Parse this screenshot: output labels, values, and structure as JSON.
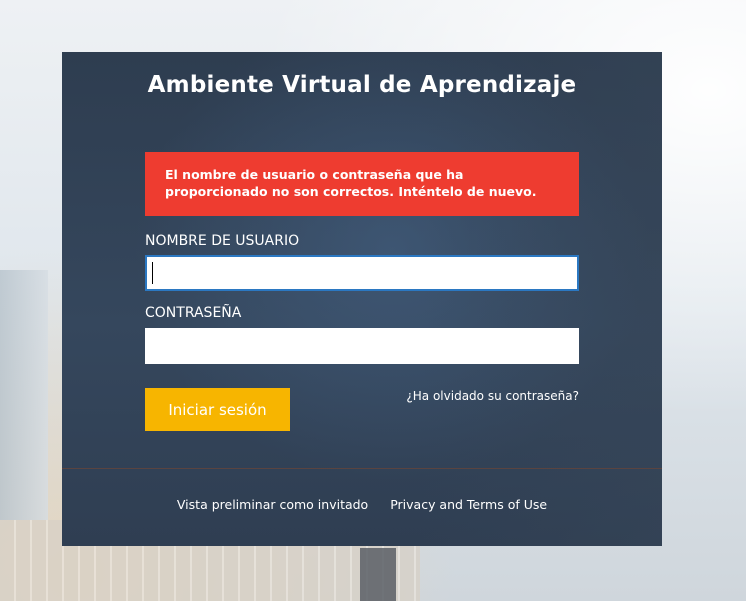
{
  "panel": {
    "title": "Ambiente Virtual de Aprendizaje",
    "error_message": "El nombre de usuario o contraseña que ha proporcionado no son correctos. Inténtelo de nuevo."
  },
  "form": {
    "username_label": "NOMBRE DE USUARIO",
    "username_value": "",
    "password_label": "CONTRASEÑA",
    "password_value": "",
    "login_button": "Iniciar sesión",
    "forgot_link": "¿Ha olvidado su contraseña?"
  },
  "footer": {
    "guest_link": "Vista preliminar como invitado",
    "privacy_link": "Privacy and Terms of Use"
  },
  "colors": {
    "panel_bg": "#33455b",
    "alert_bg": "#ee3c30",
    "button_bg": "#f7b500",
    "input_focus_border": "#2b78c2"
  }
}
